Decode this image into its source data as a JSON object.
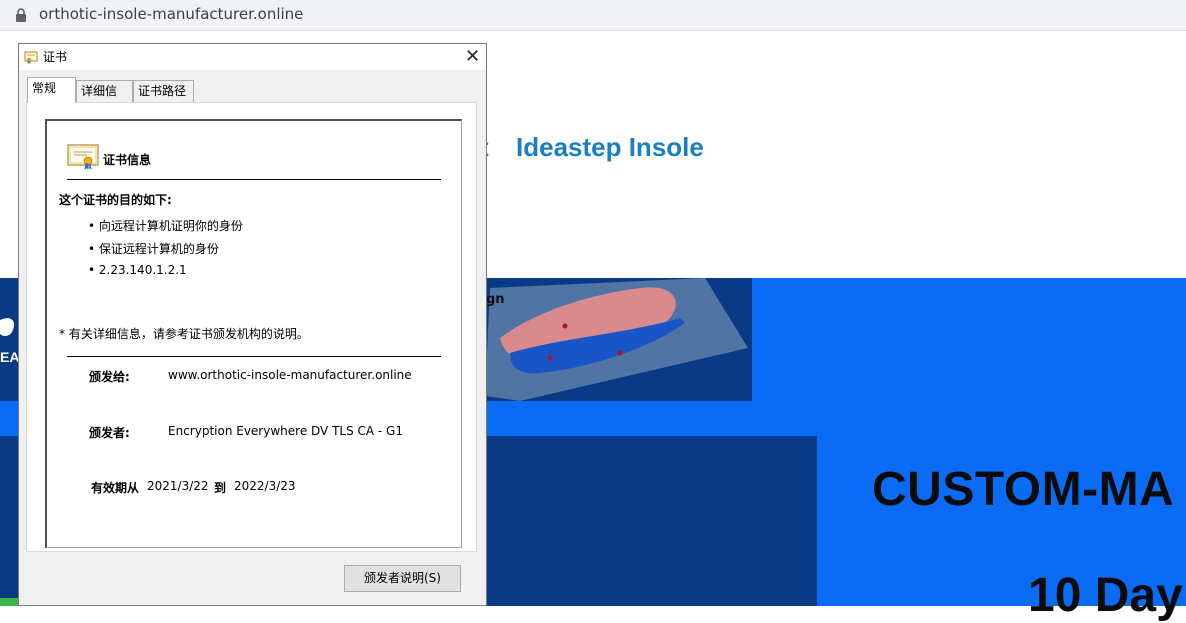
{
  "browser": {
    "url": "orthotic-insole-manufacturer.online"
  },
  "website": {
    "title_fragment": "t",
    "title": "Ideastep Insole",
    "gn_fragment": "gn",
    "hero_line1": "CUSTOM-MA",
    "hero_line2": "10 Day"
  },
  "dialog": {
    "title": "证书",
    "close_label": "✕",
    "tabs": [
      {
        "label": "常规",
        "active": true
      },
      {
        "label": "详细信息",
        "active": false
      },
      {
        "label": "证书路径",
        "active": false
      }
    ],
    "section_title": "证书信息",
    "purpose_title": "这个证书的目的如下:",
    "purposes": [
      "• 向远程计算机证明你的身份",
      "• 保证远程计算机的身份",
      "• 2.23.140.1.2.1"
    ],
    "note": "* 有关详细信息，请参考证书颁发机构的说明。",
    "issued_to_label": "颁发给:",
    "issued_to": "www.orthotic-insole-manufacturer.online",
    "issued_by_label": "颁发者:",
    "issued_by": "Encryption Everywhere DV TLS CA - G1",
    "validity_from_label": "有效期从",
    "validity_from": "2021/3/22",
    "validity_to_label": "到",
    "validity_to": "2022/3/23",
    "issuer_statement_button": "颁发者说明(S)"
  },
  "colors": {
    "site_blue": "#0a6cf5",
    "site_navy": "#0a3a86",
    "title_blue": "#1a7fc0"
  }
}
